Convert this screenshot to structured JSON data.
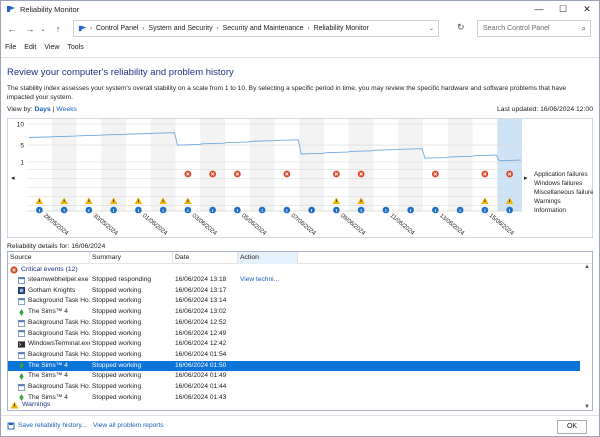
{
  "window": {
    "title": "Reliability Monitor"
  },
  "nav": {
    "breadcrumbs": [
      "Control Panel",
      "System and Security",
      "Security and Maintenance",
      "Reliability Monitor"
    ],
    "search_placeholder": "Search Control Panel"
  },
  "menu": [
    "File",
    "Edit",
    "View",
    "Tools"
  ],
  "page": {
    "heading": "Review your computer's reliability and problem history",
    "description": "The stability index assesses your system's overall stability on a scale from 1 to 10. By selecting a specific period in time, you may review the specific hardware and software problems that have impacted your system.",
    "view_by_label": "View by:",
    "view_days": "Days",
    "view_sep": "|",
    "view_weeks": "Weeks",
    "last_updated": "Last updated: 16/06/2024 12:00"
  },
  "chart_data": {
    "type": "line",
    "title": "",
    "y_ticks": [
      "10",
      "5",
      "1"
    ],
    "ylim": [
      1,
      10
    ],
    "dates": [
      "28/05/2024",
      "29/05/2024",
      "30/05/2024",
      "31/05/2024",
      "01/06/2024",
      "02/06/2024",
      "03/06/2024",
      "04/06/2024",
      "05/06/2024",
      "06/06/2024",
      "07/06/2024",
      "08/06/2024",
      "09/06/2024",
      "10/06/2024",
      "11/06/2024",
      "12/06/2024",
      "13/06/2024",
      "14/06/2024",
      "15/06/2024",
      "16/06/2024"
    ],
    "date_labels": [
      "28/05/2024",
      "30/05/2024",
      "01/06/2024",
      "03/06/2024",
      "05/06/2024",
      "07/06/2024",
      "09/06/2024",
      "11/06/2024",
      "13/06/2024",
      "15/06/2024"
    ],
    "stability": [
      6.8,
      7.0,
      7.2,
      7.4,
      7.6,
      7.8,
      5.0,
      5.3,
      5.6,
      5.9,
      6.1,
      2.9,
      3.2,
      3.5,
      3.8,
      4.0,
      1.9,
      2.2,
      2.5,
      1.3
    ],
    "rows": [
      "Application failures",
      "Windows failures",
      "Miscellaneous failures",
      "Warnings",
      "Information"
    ],
    "app_failures": [
      0,
      0,
      0,
      0,
      0,
      0,
      1,
      1,
      1,
      0,
      1,
      0,
      1,
      1,
      0,
      0,
      1,
      0,
      1,
      1
    ],
    "warnings": [
      1,
      1,
      1,
      1,
      1,
      1,
      1,
      0,
      0,
      0,
      0,
      0,
      1,
      1,
      0,
      0,
      0,
      0,
      1,
      1
    ],
    "information": [
      1,
      1,
      1,
      1,
      1,
      1,
      1,
      1,
      1,
      1,
      1,
      1,
      1,
      1,
      1,
      1,
      1,
      1,
      1,
      1
    ],
    "selected_index": 19,
    "colors": {
      "line": "#6fa8dc",
      "selected": "#cfe3f7",
      "failure": "#d9472b",
      "warning": "#f0b400",
      "info": "#1f6fc5"
    }
  },
  "details": {
    "label": "Reliability details for: 16/06/2024",
    "columns": [
      "Source",
      "Summary",
      "Date",
      "Action"
    ],
    "group_critical": "Critical events (12)",
    "group_warnings": "Warnings",
    "rows": [
      {
        "source": "steamwebhelper.exe",
        "summary": "Stopped responding",
        "date": "16/06/2024 13:18",
        "action": "View techni...",
        "icon": "app-icon"
      },
      {
        "source": "Gotham Knights",
        "summary": "Stopped working",
        "date": "16/06/2024 13:17",
        "action": "",
        "icon": "game-icon"
      },
      {
        "source": "Background Task Ho...",
        "summary": "Stopped working",
        "date": "16/06/2024 13:14",
        "action": "",
        "icon": "app-icon"
      },
      {
        "source": "The Sims™ 4",
        "summary": "Stopped working",
        "date": "16/06/2024 13:02",
        "action": "",
        "icon": "sims-icon"
      },
      {
        "source": "Background Task Ho...",
        "summary": "Stopped working",
        "date": "16/06/2024 12:52",
        "action": "",
        "icon": "app-icon"
      },
      {
        "source": "Background Task Ho...",
        "summary": "Stopped working",
        "date": "16/06/2024 12:49",
        "action": "",
        "icon": "app-icon"
      },
      {
        "source": "WindowsTerminal.exe",
        "summary": "Stopped working",
        "date": "16/06/2024 12:42",
        "action": "",
        "icon": "terminal-icon"
      },
      {
        "source": "Background Task Ho...",
        "summary": "Stopped working",
        "date": "16/06/2024 01:54",
        "action": "",
        "icon": "app-icon"
      },
      {
        "source": "The Sims™ 4",
        "summary": "Stopped working",
        "date": "16/06/2024 01:50",
        "action": "",
        "icon": "sims-icon",
        "selected": true
      },
      {
        "source": "The Sims™ 4",
        "summary": "Stopped working",
        "date": "16/06/2024 01:49",
        "action": "",
        "icon": "sims-icon"
      },
      {
        "source": "Background Task Ho...",
        "summary": "Stopped working",
        "date": "16/06/2024 01:44",
        "action": "",
        "icon": "app-icon"
      },
      {
        "source": "The Sims™ 4",
        "summary": "Stopped working",
        "date": "16/06/2024 01:43",
        "action": "",
        "icon": "sims-icon"
      }
    ]
  },
  "footer": {
    "save_link": "Save reliability history...",
    "view_all_link": "View all problem reports",
    "ok_label": "OK"
  }
}
